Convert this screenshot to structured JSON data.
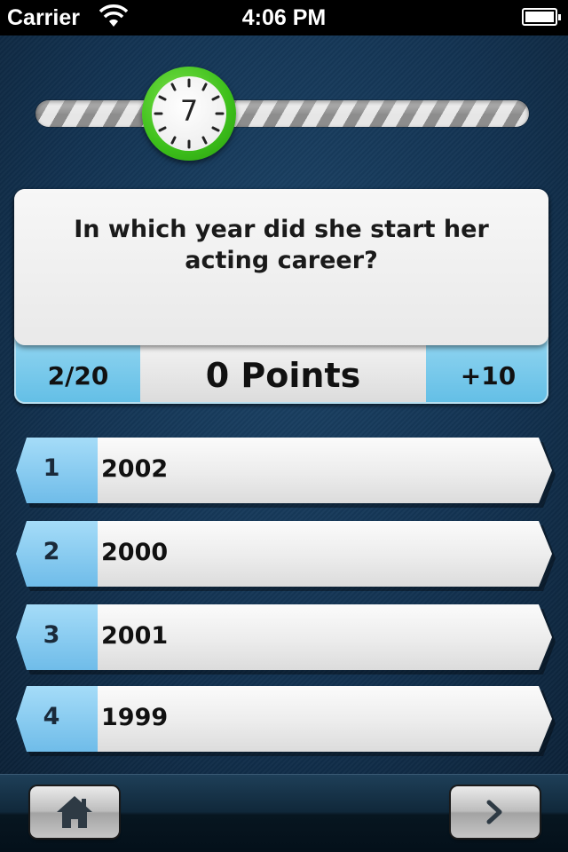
{
  "status_bar": {
    "carrier": "Carrier",
    "time": "4:06 PM"
  },
  "timer": {
    "seconds": "7"
  },
  "question": {
    "text": "In which year did she start her acting career?",
    "progress": "2/20",
    "points": "0 Points",
    "bonus": "+10"
  },
  "answers": [
    {
      "number": "1",
      "label": "2002"
    },
    {
      "number": "2",
      "label": "2000"
    },
    {
      "number": "3",
      "label": "2001"
    },
    {
      "number": "4",
      "label": "1999"
    }
  ],
  "toolbar": {
    "home_icon": "home-icon",
    "next_icon": "chevron-right-icon"
  },
  "colors": {
    "background": "#133352",
    "accent_blue": "#64bfe6",
    "timer_green": "#3cbf1a"
  }
}
